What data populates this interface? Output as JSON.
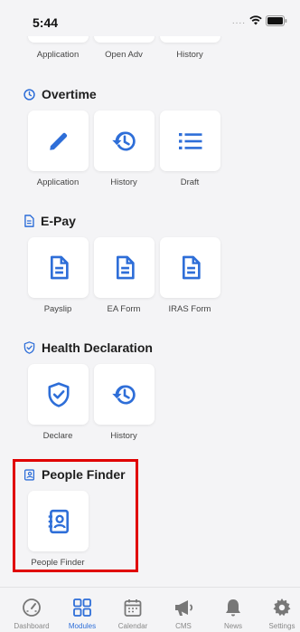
{
  "status_bar": {
    "time": "5:44",
    "signal_dots": "...."
  },
  "top_section": {
    "items": [
      {
        "label": "Application"
      },
      {
        "label": "Open Adv"
      },
      {
        "label": "History"
      }
    ]
  },
  "overtime": {
    "title": "Overtime",
    "items": [
      {
        "label": "Application",
        "icon": "pencil-icon"
      },
      {
        "label": "History",
        "icon": "history-icon"
      },
      {
        "label": "Draft",
        "icon": "list-icon"
      }
    ]
  },
  "epay": {
    "title": "E-Pay",
    "items": [
      {
        "label": "Payslip",
        "icon": "document-icon"
      },
      {
        "label": "EA Form",
        "icon": "document-icon"
      },
      {
        "label": "IRAS Form",
        "icon": "document-icon"
      }
    ]
  },
  "health": {
    "title": "Health Declaration",
    "items": [
      {
        "label": "Declare",
        "icon": "shield-check-icon"
      },
      {
        "label": "History",
        "icon": "history-icon"
      }
    ]
  },
  "people_finder": {
    "title": "People Finder",
    "items": [
      {
        "label": "People Finder",
        "icon": "contact-card-icon"
      }
    ]
  },
  "bottom_nav": {
    "active": "Modules",
    "items": [
      {
        "label": "Dashboard"
      },
      {
        "label": "Modules"
      },
      {
        "label": "Calendar"
      },
      {
        "label": "CMS"
      },
      {
        "label": "News"
      },
      {
        "label": "Settings"
      }
    ]
  },
  "colors": {
    "accent": "#2e6ed8",
    "highlight": "#e00000",
    "background": "#f4f4f6"
  }
}
